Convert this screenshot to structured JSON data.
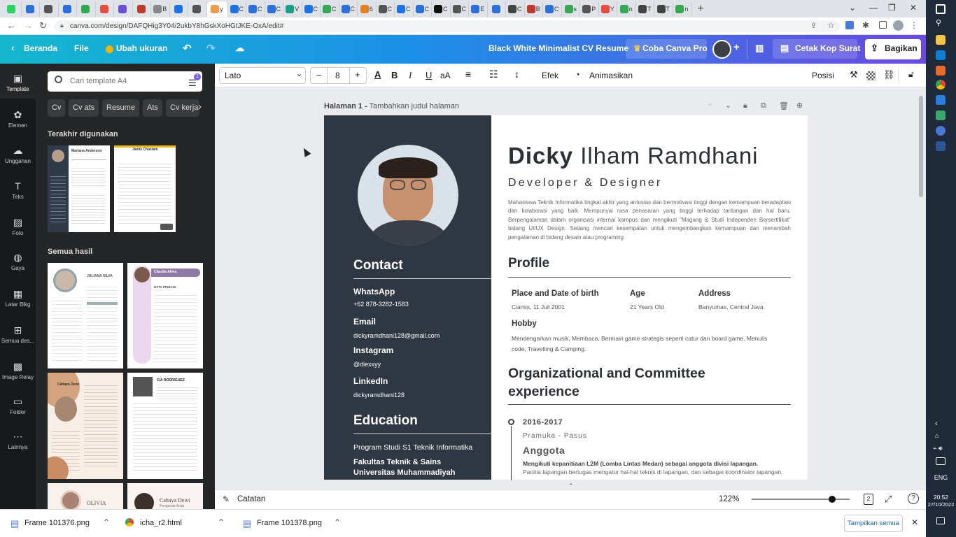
{
  "browser": {
    "tab_labels": [
      "",
      "",
      "",
      "",
      "",
      "",
      "",
      "",
      "B",
      "",
      "",
      "y",
      "C",
      "C",
      "C",
      "V",
      "C",
      "C",
      "C",
      "6",
      "C",
      "C",
      "C",
      "C",
      "C",
      "E",
      "",
      "C",
      "B",
      "C",
      "s",
      "P",
      "Y",
      "n",
      "T",
      "T",
      "n"
    ],
    "new_tab": "+",
    "url": "canva.com/design/DAFQHig3Y04/2ukbY8hGskXoHGtJKE-OxA/edit#"
  },
  "header": {
    "back_label": "Beranda",
    "file_label": "File",
    "resize_label": "Ubah ukuran",
    "title": "Black White Minimalist CV Resume",
    "try_pro": "Coba Canva Pro",
    "print_label": "Cetak Kop Surat",
    "share_label": "Bagikan",
    "colors": {
      "start": "#14b7cf",
      "end": "#6a49e0"
    }
  },
  "rail": {
    "items": [
      {
        "label": "Template",
        "icon": "template-icon"
      },
      {
        "label": "Elemen",
        "icon": "elements-icon"
      },
      {
        "label": "Unggahan",
        "icon": "upload-icon"
      },
      {
        "label": "Teks",
        "icon": "text-icon"
      },
      {
        "label": "Foto",
        "icon": "photo-icon"
      },
      {
        "label": "Gaya",
        "icon": "style-icon"
      },
      {
        "label": "Latar Blkg",
        "icon": "background-icon"
      },
      {
        "label": "Semua des...",
        "icon": "designs-icon"
      },
      {
        "label": "Image Relay",
        "icon": "image-relay-icon"
      },
      {
        "label": "Folder",
        "icon": "folder-icon"
      },
      {
        "label": "Lainnya",
        "icon": "more-icon"
      }
    ]
  },
  "panel": {
    "search_placeholder": "Cari template A4",
    "filter_badge": "1",
    "chips": [
      "Cv",
      "Cv ats",
      "Resume",
      "Ats",
      "Cv kerja"
    ],
    "recent_heading": "Terakhir digunakan",
    "all_heading": "Semua hasil",
    "recent": [
      {
        "name": "Mariana Anderson"
      },
      {
        "name": "Jamie Chastain"
      }
    ],
    "results": [
      {
        "name": "JULIANA SILVA"
      },
      {
        "name": "Claudia Alves",
        "sub": "DATA PRIBADI"
      },
      {
        "name": "Cahaya Dewi"
      },
      {
        "name": "CIA RODRIGUEZ"
      },
      {
        "name": "OLIVIA"
      },
      {
        "name": "Cahaya Dewi",
        "sub": "Pengamat Acak"
      }
    ]
  },
  "toolbar": {
    "font": "Lato",
    "minus": "−",
    "font_size": "8",
    "plus": "+",
    "bold": "B",
    "italic": "I",
    "underline": "U",
    "case": "aA",
    "effects": "Efek",
    "animate": "Animasikan",
    "position": "Posisi"
  },
  "page": {
    "label": "Halaman 1 -",
    "title_placeholder": "Tambahkan judul halaman"
  },
  "cv": {
    "first_name": "Dicky",
    "last_name": "Ilham Ramdhani",
    "role": "Developer & Designer",
    "summary": "Mahasiswa Teknik Informatika tingkat akhir yang antusias dan bermotivasi tinggi dengan kemampuan beradaptasi dan kolaborasi yang baik. Mempunyai rasa penasaran yang tinggi terhadap tantangan dan hal baru. Berpengalaman dalam organisasi internal kampus dan mengikuti \"Magang & Studi Independen Bersertifikat\" bidang UI/UX Design. Sedang mencari kesempatan untuk mengembangkan kemampuan dan menambah pengalaman di bidang desain atau programing.",
    "contact_heading": "Contact",
    "contacts": [
      {
        "label": "WhatsApp",
        "value": "+62 878-3282-1583"
      },
      {
        "label": "Email",
        "value": "dickyramdhani128@gmail.com"
      },
      {
        "label": "Instagram",
        "value": "@diexxyy"
      },
      {
        "label": "LinkedIn",
        "value": "dickyramdhani128"
      }
    ],
    "education_heading": "Education",
    "education": {
      "program": "Program Studi S1 Teknik Informatika",
      "faculty": "Fakultas Teknik & Sains",
      "university": "Universitas Muhammadiyah"
    },
    "profile_heading": "Profile",
    "profile": {
      "birth_label": "Place and Date of birth",
      "birth_value": "Ciamis, 11 Juli 2001",
      "age_label": "Age",
      "age_value": "21 Years Old",
      "address_label": "Address",
      "address_value": "Banyumas, Central Java",
      "hobby_label": "Hobby",
      "hobby_value": "Mendengarkan musik, Membaca, Bermain game strategis seperti catur dan board game, Menulis code, Travelling & Camping."
    },
    "org_heading": "Organizational and Committee experience",
    "org": {
      "years": "2016-2017",
      "org_name": "Pramuka - Pasus",
      "position": "Anggota",
      "bold_line": "Mengikuti kepanitiaan L2M (Lomba Lintas Medan) sebagai anggota divisi lapangan.",
      "desc": "Panitia lapangan bertugas mengatur hal-hal teknis di lapangan, dan sebagai koordinator lapangan."
    },
    "colors": {
      "sidebar": "#2f3742",
      "heading": "#2b2f36"
    }
  },
  "bottom": {
    "notes": "Catatan",
    "zoom": "122%",
    "zoom_fraction": 0.82,
    "page_count": "2"
  },
  "downloads": {
    "items": [
      "Frame 101376.png",
      "icha_r2.html",
      "Frame 101378.png"
    ],
    "show_all": "Tampilkan semua"
  },
  "taskbar": {
    "lang": "ENG",
    "time": "20:52",
    "date": "27/10/2022"
  }
}
